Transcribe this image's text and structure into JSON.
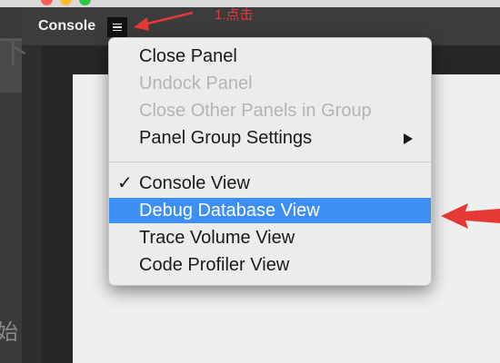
{
  "panel": {
    "tab_label": "Console",
    "menu_button_icon": "hamburger-icon"
  },
  "annotation": {
    "note_text": "1.点击",
    "arrow_color": "#e53935"
  },
  "background": {
    "glyph_top": "下",
    "glyph_bottom": "始"
  },
  "menu": {
    "group1": [
      {
        "label": "Close Panel",
        "enabled": true
      },
      {
        "label": "Undock Panel",
        "enabled": false
      },
      {
        "label": "Close Other Panels in Group",
        "enabled": false
      },
      {
        "label": "Panel Group Settings",
        "enabled": true,
        "has_submenu": true
      }
    ],
    "group2": [
      {
        "label": "Console View",
        "checked": true
      },
      {
        "label": "Debug Database View",
        "highlighted": true
      },
      {
        "label": "Trace Volume View"
      },
      {
        "label": "Code Profiler View"
      }
    ],
    "check_glyph": "✓",
    "highlight_color": "#3d8ef5"
  }
}
